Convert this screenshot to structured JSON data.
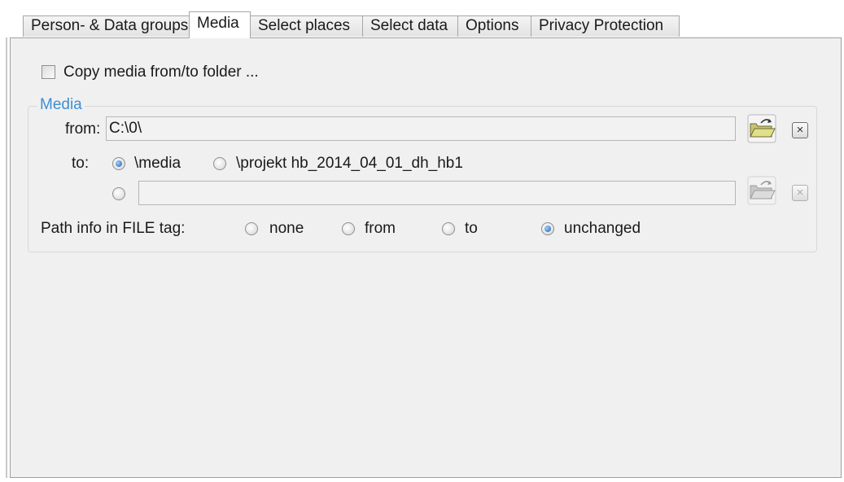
{
  "tabs": [
    {
      "label": "Person- & Data groups"
    },
    {
      "label": "Media"
    },
    {
      "label": "Select places"
    },
    {
      "label": "Select data"
    },
    {
      "label": "Options"
    },
    {
      "label": "Privacy Protection"
    }
  ],
  "active_tab": "Media",
  "copy_media": {
    "label": "Copy media from/to folder ...",
    "checked": false
  },
  "media_group": {
    "legend": "Media",
    "from_label": "from:",
    "from_value": "C:\\0\\",
    "to_label": "to:",
    "to_options": [
      {
        "label": "\\media",
        "selected": true
      },
      {
        "label": "\\projekt hb_2014_04_01_dh_hb1",
        "selected": false
      }
    ],
    "custom_path_value": "",
    "custom_path_selected": false,
    "path_info_label": "Path info in FILE tag:",
    "path_info_options": [
      {
        "label": "none",
        "selected": false
      },
      {
        "label": "from",
        "selected": false
      },
      {
        "label": "to",
        "selected": false
      },
      {
        "label": "unchanged",
        "selected": true
      }
    ]
  },
  "icons": {
    "browse": "folder-open-icon",
    "clear": "close-icon",
    "clear_glyph": "×"
  }
}
